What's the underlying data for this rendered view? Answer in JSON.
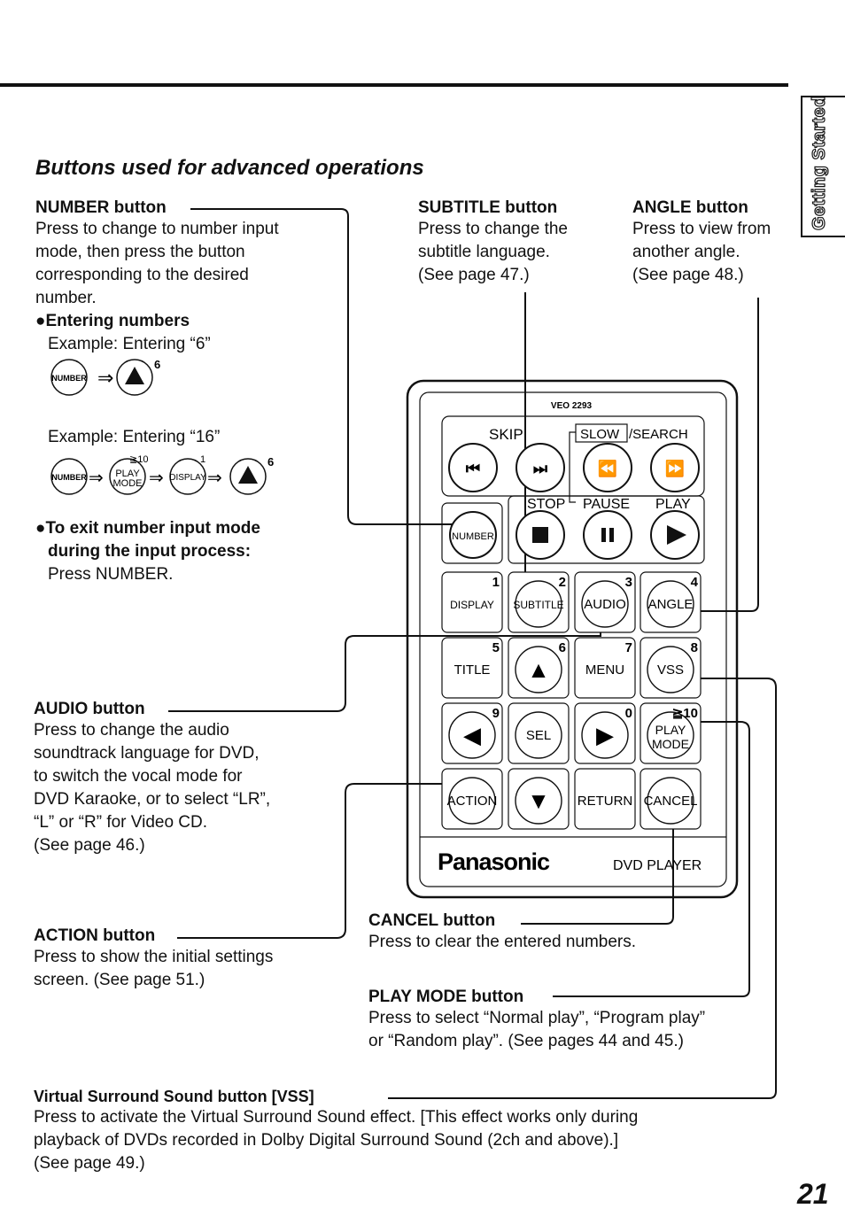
{
  "page": {
    "section_tab": "Getting Started",
    "title": "Buttons used for advanced operations",
    "page_number": "21"
  },
  "number_button": {
    "heading": "NUMBER button",
    "lines": [
      "Press to change to number input",
      "mode, then press the button",
      "corresponding to the desired",
      "number."
    ],
    "entering_heading": "Entering numbers",
    "example1": "Example: Entering “6”",
    "example2": "Example: Entering “16”",
    "exit_heading_1": "To exit number input mode",
    "exit_heading_2": "during the input process:",
    "exit_text": "Press NUMBER.",
    "diagram": {
      "number_label": "NUMBER",
      "play_mode_label_1": "PLAY",
      "play_mode_label_2": "MODE",
      "play_mode_num": "≧10",
      "display_label": "DISPLAY",
      "display_num": "1",
      "up_num": "6",
      "arrow": "⇒"
    }
  },
  "subtitle_button": {
    "heading": "SUBTITLE button",
    "lines": [
      "Press to change the",
      "subtitle language.",
      "(See page 47.)"
    ]
  },
  "angle_button": {
    "heading": "ANGLE button",
    "lines": [
      "Press to view from",
      "another angle.",
      "(See page 48.)"
    ]
  },
  "audio_button": {
    "heading": "AUDIO button",
    "lines": [
      "Press to change the audio",
      "soundtrack language for DVD,",
      "to switch the vocal mode for",
      "DVD Karaoke, or to select “LR”,",
      "“L” or “R” for Video CD.",
      "(See page 46.)"
    ]
  },
  "action_button": {
    "heading": "ACTION button",
    "lines": [
      "Press to show the initial settings",
      "screen. (See page 51.)"
    ]
  },
  "cancel_button": {
    "heading": "CANCEL button",
    "lines": [
      "Press to clear the entered numbers."
    ]
  },
  "play_mode_button": {
    "heading": "PLAY MODE button",
    "lines": [
      "Press to select “Normal play”, “Program play”",
      "or “Random play”. (See pages 44 and 45.)"
    ]
  },
  "vss_button": {
    "heading": "Virtual Surround Sound button [VSS]",
    "lines": [
      "Press to activate the Virtual Surround Sound effect. [This effect works only during",
      "playback of DVDs recorded in Dolby Digital Surround Sound (2ch and above).]",
      "(See page 49.)"
    ]
  },
  "remote": {
    "model": "VEO 2293",
    "skip_label": "SKIP",
    "slow_label": "SLOW",
    "search_label": "/SEARCH",
    "stop_label": "STOP",
    "pause_label": "PAUSE",
    "play_label": "PLAY",
    "number_label": "NUMBER",
    "brand": "Panasonic",
    "product": "DVD PLAYER",
    "keys": [
      {
        "label": "DISPLAY",
        "num": "1"
      },
      {
        "label": "SUBTITLE",
        "num": "2"
      },
      {
        "label": "AUDIO",
        "num": "3"
      },
      {
        "label": "ANGLE",
        "num": "4"
      },
      {
        "label": "TITLE",
        "num": "5"
      },
      {
        "label": "▲",
        "num": "6"
      },
      {
        "label": "MENU",
        "num": "7"
      },
      {
        "label": "VSS",
        "num": "8"
      },
      {
        "label": "◀",
        "num": "9"
      },
      {
        "label": "SEL",
        "num": ""
      },
      {
        "label": "▶",
        "num": "0"
      },
      {
        "label": "PLAY MODE",
        "num": "≧10"
      },
      {
        "label": "ACTION",
        "num": ""
      },
      {
        "label": "▼",
        "num": ""
      },
      {
        "label": "RETURN",
        "num": ""
      },
      {
        "label": "CANCEL",
        "num": ""
      }
    ]
  }
}
